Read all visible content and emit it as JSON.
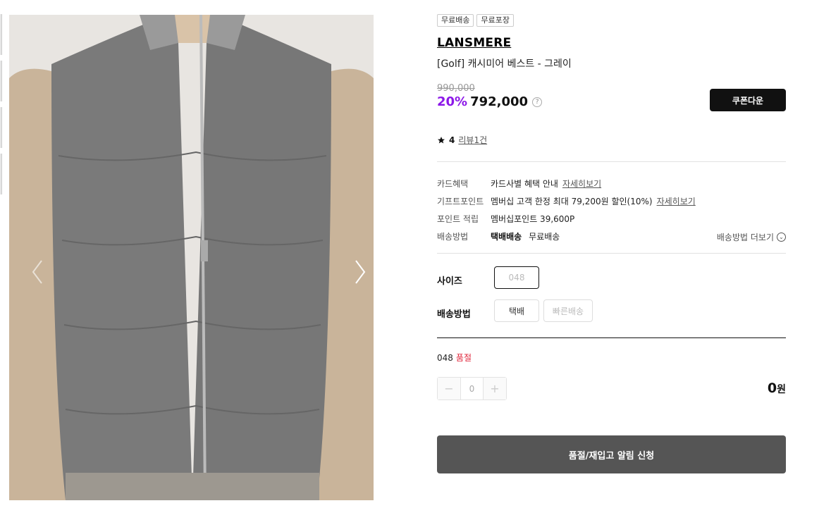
{
  "tags": [
    "무료배송",
    "무료포장"
  ],
  "brand": "LANSMERE",
  "product_name": "[Golf] 캐시미어 베스트 - 그레이",
  "price": {
    "original": "990,000",
    "discount": "20%",
    "sale": "792,000",
    "help_icon": "?"
  },
  "coupon_button": "쿠폰다운",
  "rating": {
    "score": "4",
    "reviews": "리뷰1건"
  },
  "benefits": {
    "card": {
      "label": "카드혜택",
      "value": "카드사별 혜택 안내",
      "link": "자세히보기"
    },
    "gift": {
      "label": "기프트포인트",
      "value": "멤버십 고객 한정 최대 79,200원 할인(10%)",
      "link": "자세히보기"
    },
    "points": {
      "label": "포인트 적립",
      "value": "멤버십포인트 39,600P"
    },
    "delivery": {
      "label": "배송방법",
      "method": "택배배송",
      "fee": "무료배송",
      "more": "배송방법 더보기"
    }
  },
  "options": {
    "size_label": "사이즈",
    "size_value": "048",
    "delivery_label": "배송방법",
    "delivery_opt1": "택배",
    "delivery_opt2": "빠른배송"
  },
  "selected": {
    "size": "048",
    "status": "품절"
  },
  "quantity": {
    "minus": "−",
    "value": "0",
    "plus": "+"
  },
  "total": {
    "amount": "0",
    "unit": "원"
  },
  "cta_button": "품절/재입고 알림 신청"
}
